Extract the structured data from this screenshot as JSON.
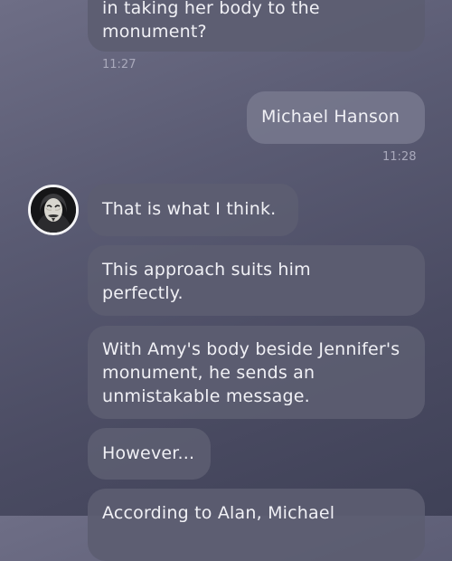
{
  "messages": [
    {
      "text": "in taking her body to the monument?",
      "time": "11:27",
      "side": "in"
    },
    {
      "text": "Michael Hanson",
      "time": "11:28",
      "side": "out"
    },
    {
      "text": "That is what I think.",
      "side": "in"
    },
    {
      "text": "This approach suits him perfectly.",
      "side": "in"
    },
    {
      "text": "With Amy's body beside Jennifer's monument, he sends an unmistakable message.",
      "side": "in"
    },
    {
      "text": "However...",
      "side": "in"
    },
    {
      "text": "According to Alan, Michael",
      "side": "in"
    }
  ],
  "avatar_icon": "masked-figure-icon",
  "colors": {
    "background_top": "#6e6e86",
    "background_bottom": "#3f4157",
    "bubble_incoming": "#5c5d71",
    "bubble_outgoing": "#78798e",
    "text": "#f0f0f5",
    "timestamp": "#a9a9bb"
  }
}
